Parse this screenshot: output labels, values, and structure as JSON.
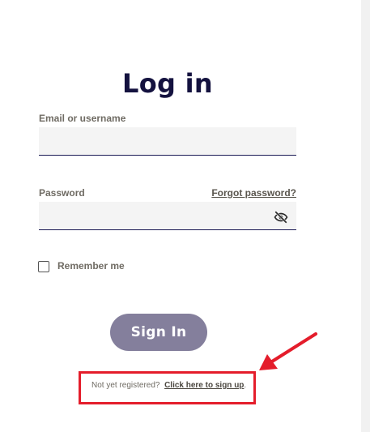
{
  "page": {
    "title": "Log in"
  },
  "login_form": {
    "email_label": "Email or username",
    "email_value": "",
    "password_label": "Password",
    "password_value": "",
    "forgot_password": "Forgot password?",
    "remember_me": "Remember me",
    "remember_checked": false,
    "sign_in": "Sign In"
  },
  "signup": {
    "prompt": "Not yet registered?",
    "link": "Click here to sign up",
    "suffix": "."
  },
  "icons": {
    "password_toggle": "eye-slash-icon",
    "annotation_arrow": "arrow-icon"
  },
  "colors": {
    "title": "#14123f",
    "sign_in_button": "#847f9c",
    "field_underline": "#1b1a55",
    "annotation": "#e41d2b"
  }
}
